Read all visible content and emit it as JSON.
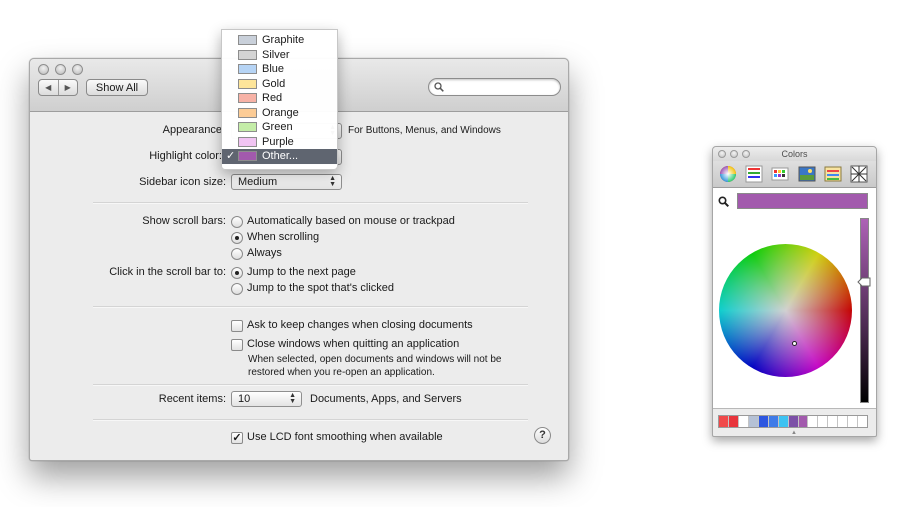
{
  "window": {
    "show_all": "Show All",
    "nav_back": "◀",
    "nav_forward": "▶"
  },
  "prefs": {
    "appearance_label": "Appearance",
    "appearance_note": "For Buttons, Menus, and Windows",
    "highlight_label": "Highlight color:",
    "highlight_value": "Other...",
    "sidebar_label": "Sidebar icon size:",
    "sidebar_value": "Medium",
    "scrollbars_label": "Show scroll bars:",
    "scrollbars_options": [
      {
        "label": "Automatically based on mouse or trackpad",
        "selected": false
      },
      {
        "label": "When scrolling",
        "selected": true
      },
      {
        "label": "Always",
        "selected": false
      }
    ],
    "click_label": "Click in the scroll bar to:",
    "click_options": [
      {
        "label": "Jump to the next page",
        "selected": true
      },
      {
        "label": "Jump to the spot that's clicked",
        "selected": false
      }
    ],
    "ask_keep": {
      "label": "Ask to keep changes when closing documents",
      "checked": false
    },
    "close_windows": {
      "label": "Close windows when quitting an application",
      "checked": false
    },
    "close_windows_note_1": "When selected, open documents and windows will not be",
    "close_windows_note_2": "restored when you re-open an application.",
    "recent_label": "Recent items:",
    "recent_value": "10",
    "recent_note": "Documents, Apps, and Servers",
    "lcd": {
      "label": "Use LCD font smoothing when available",
      "checked": true
    },
    "help": "?"
  },
  "highlight_menu": {
    "checkmark": "✓",
    "items": [
      {
        "label": "Graphite",
        "color": "#c9d0da"
      },
      {
        "label": "Silver",
        "color": "#d4d4d4"
      },
      {
        "label": "Blue",
        "color": "#b6d4f5"
      },
      {
        "label": "Gold",
        "color": "#fde59a"
      },
      {
        "label": "Red",
        "color": "#f7b2a6"
      },
      {
        "label": "Orange",
        "color": "#fccc96"
      },
      {
        "label": "Green",
        "color": "#c4eda8"
      },
      {
        "label": "Purple",
        "color": "#f1c4f3"
      },
      {
        "label": "Other...",
        "color": "#a25aad",
        "selected": true
      }
    ]
  },
  "colors_panel": {
    "title": "Colors",
    "current_color": "#a25aad",
    "swatches": [
      "#f0494a",
      "#e8353c",
      "#ffffff",
      "#b5c1d5",
      "#2d56e0",
      "#3f7be8",
      "#3dc2f2",
      "#7c50a7",
      "#a25aad",
      "#ffffff",
      "#ffffff",
      "#ffffff",
      "#ffffff",
      "#ffffff",
      "#ffffff"
    ]
  }
}
